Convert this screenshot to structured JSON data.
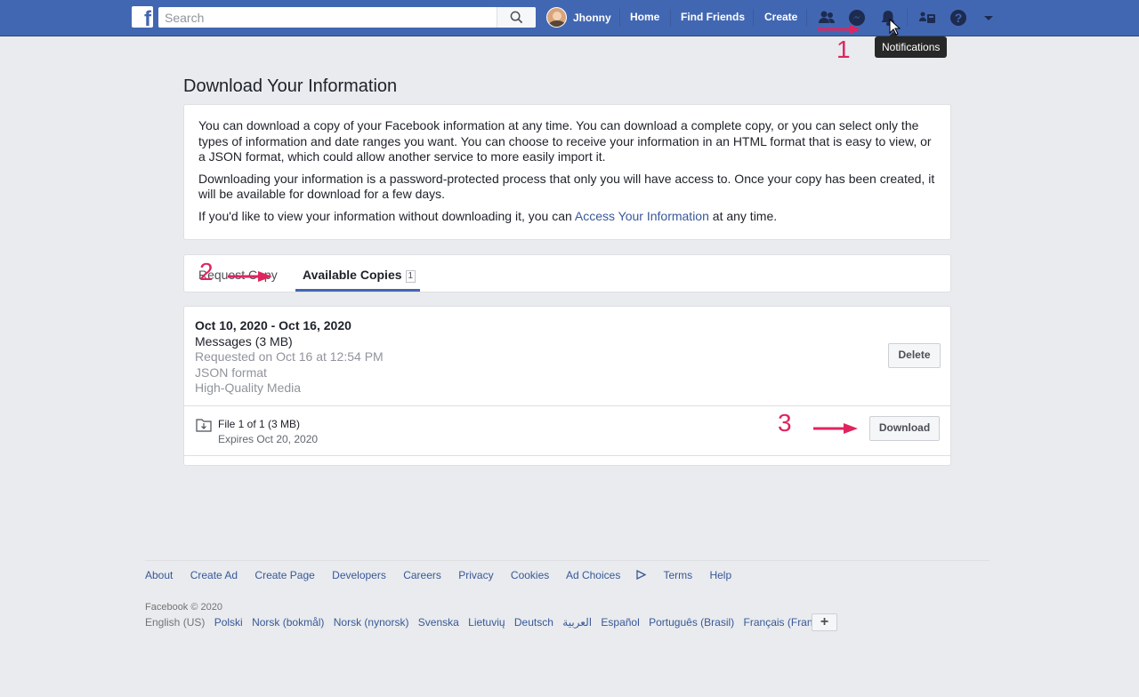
{
  "topbar": {
    "logo": "f",
    "search_placeholder": "Search",
    "profile_name": "Jhonny",
    "links": [
      "Home",
      "Find Friends",
      "Create"
    ],
    "icons": [
      "friends-icon",
      "messenger-icon",
      "notifications-icon",
      "groups-icon",
      "help-icon",
      "dropdown-icon"
    ],
    "tooltip": "Notifications"
  },
  "annotations": {
    "step1": "1",
    "step2": "2",
    "step3": "3"
  },
  "page": {
    "title": "Download Your Information",
    "intro": {
      "p1": "You can download a copy of your Facebook information at any time. You can download a complete copy, or you can select only the types of information and date ranges you want. You can choose to receive your information in an HTML format that is easy to view, or a JSON format, which could allow another service to more easily import it.",
      "p2": "Downloading your information is a password-protected process that only you will have access to. Once your copy has been created, it will be available for download for a few days.",
      "p3_before": "If you'd like to view your information without downloading it, you can ",
      "p3_link": "Access Your Information",
      "p3_after": " at any time."
    },
    "tabs": {
      "request": "Request Copy",
      "available": "Available Copies",
      "available_count": "1"
    },
    "copy": {
      "date_range": "Oct 10, 2020 - Oct 16, 2020",
      "content": "Messages (3 MB)",
      "requested": "Requested on Oct 16 at 12:54 PM",
      "format": "JSON format",
      "media": "High-Quality Media",
      "delete_label": "Delete",
      "file_name": "File 1 of 1 (3 MB)",
      "file_expires": "Expires Oct 20, 2020",
      "download_label": "Download"
    }
  },
  "footer": {
    "links": [
      "About",
      "Create Ad",
      "Create Page",
      "Developers",
      "Careers",
      "Privacy",
      "Cookies",
      "Ad Choices",
      "Terms",
      "Help"
    ],
    "copyright": "Facebook © 2020",
    "languages": [
      "English (US)",
      "Polski",
      "Norsk (bokmål)",
      "Norsk (nynorsk)",
      "Svenska",
      "Lietuvių",
      "Deutsch",
      "العربية",
      "Español",
      "Português (Brasil)",
      "Français (France)"
    ],
    "add_language": "+"
  }
}
